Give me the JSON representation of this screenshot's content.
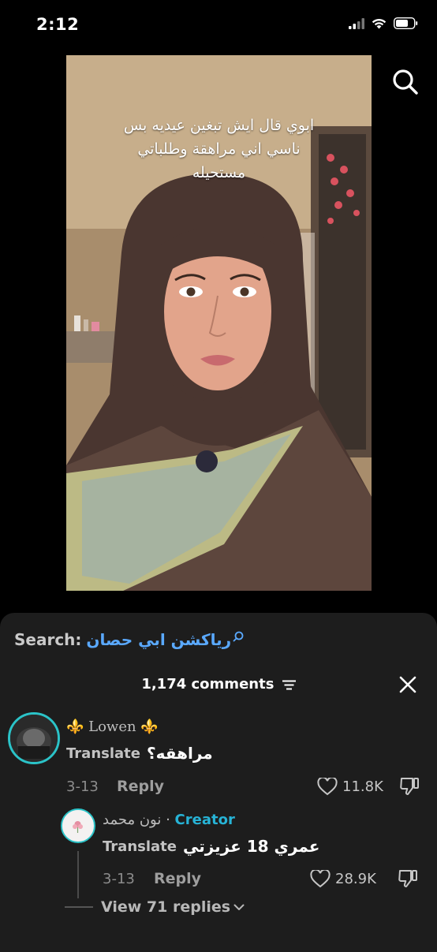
{
  "status": {
    "time": "2:12"
  },
  "video": {
    "caption_lines": [
      "ابوي قال ايش تبغين عيديه بس",
      "ناسي اني مراهقة وطلباتي",
      "مستحيله"
    ]
  },
  "comments_panel": {
    "search_label": "Search:",
    "search_query": "رياكشن ابي حصان",
    "count_text": "1,174 comments",
    "comments": [
      {
        "username": "⚜️ Lowen ⚜️",
        "translate": "Translate",
        "text": "مراهقه؟",
        "date": "3-13",
        "reply_label": "Reply",
        "likes": "11.8K"
      },
      {
        "username": "نون محمد",
        "separator": " · ",
        "creator_badge": "Creator",
        "translate": "Translate",
        "text": "عمري 18 عزيزتي",
        "date": "3-13",
        "reply_label": "Reply",
        "likes": "28.9K"
      }
    ],
    "view_replies": "View 71 replies"
  },
  "colors": {
    "accent_teal": "#2bc3c8",
    "creator_blue": "#27b3d6",
    "search_blue": "#5aa9ff",
    "sheet_bg": "#1d1d1d"
  },
  "icons": [
    "search-icon",
    "filter-icon",
    "close-icon",
    "heart-icon",
    "dislike-icon",
    "chevron-down-icon",
    "signal-icon",
    "wifi-icon",
    "battery-icon"
  ]
}
